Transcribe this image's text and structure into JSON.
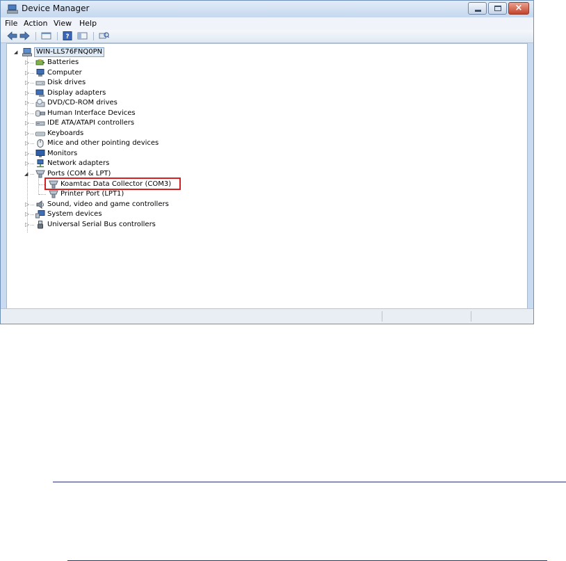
{
  "window": {
    "title": "Device Manager",
    "title_icon": "computer-management-icon",
    "caption_buttons": {
      "minimize": "minimize-icon",
      "maximize": "maximize-icon",
      "close": "×"
    }
  },
  "menu": [
    "File",
    "Action",
    "View",
    "Help"
  ],
  "toolbar": [
    "back-arrow-icon",
    "forward-arrow-icon",
    "properties-icon",
    "help-icon",
    "show-hide-console-tree-icon",
    "scan-hardware-icon"
  ],
  "tree": {
    "root": "WIN-LLS76FNQ0PN",
    "items": [
      {
        "label": "Batteries",
        "icon": "battery-icon",
        "expanded": false
      },
      {
        "label": "Computer",
        "icon": "computer-icon",
        "expanded": false
      },
      {
        "label": "Disk drives",
        "icon": "disk-drive-icon",
        "expanded": false
      },
      {
        "label": "Display adapters",
        "icon": "display-adapter-icon",
        "expanded": false
      },
      {
        "label": "DVD/CD-ROM drives",
        "icon": "dvd-drive-icon",
        "expanded": false
      },
      {
        "label": "Human Interface Devices",
        "icon": "hid-icon",
        "expanded": false
      },
      {
        "label": "IDE ATA/ATAPI controllers",
        "icon": "ide-controller-icon",
        "expanded": false
      },
      {
        "label": "Keyboards",
        "icon": "keyboard-icon",
        "expanded": false
      },
      {
        "label": "Mice and other pointing devices",
        "icon": "mouse-icon",
        "expanded": false
      },
      {
        "label": "Monitors",
        "icon": "monitor-icon",
        "expanded": false
      },
      {
        "label": "Network adapters",
        "icon": "network-adapter-icon",
        "expanded": false
      },
      {
        "label": "Ports (COM & LPT)",
        "icon": "port-icon",
        "expanded": true,
        "children": [
          {
            "label": "Koamtac Data Collector (COM3)",
            "icon": "port-icon",
            "highlighted": true
          },
          {
            "label": "Printer Port (LPT1)",
            "icon": "port-icon"
          }
        ]
      },
      {
        "label": "Sound, video and game controllers",
        "icon": "speaker-icon",
        "expanded": false
      },
      {
        "label": "System devices",
        "icon": "system-device-icon",
        "expanded": false
      },
      {
        "label": "Universal Serial Bus controllers",
        "icon": "usb-icon",
        "expanded": false
      }
    ]
  },
  "colors": {
    "highlight_border": "#d42020",
    "window_frame": "#c9dbf0",
    "rule_lines": "#2b2f7a"
  }
}
